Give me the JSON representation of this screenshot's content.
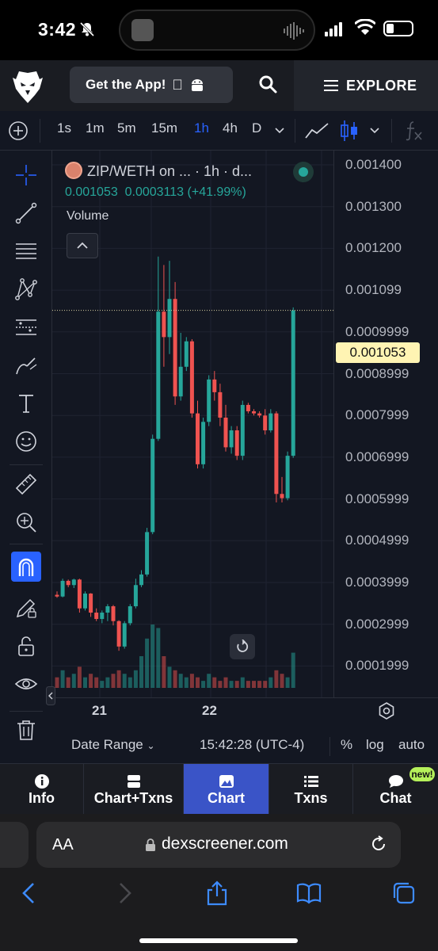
{
  "status_bar": {
    "time": "3:42"
  },
  "header": {
    "get_app_label": "Get the App!",
    "explore_label": "EXPLORE"
  },
  "toolbar": {
    "intervals": [
      "1s",
      "1m",
      "5m",
      "15m",
      "1h",
      "4h",
      "D"
    ],
    "active_interval": "1h"
  },
  "legend": {
    "pair": "ZIP/WETH on ... · 1h · d...",
    "price": "0.001053",
    "change": "0.0003113 (+41.99%)",
    "volume_label": "Volume"
  },
  "price_axis": {
    "labels": [
      "0.001400",
      "0.001300",
      "0.001200",
      "0.001099",
      "0.0009999",
      "0.0008999",
      "0.0007999",
      "0.0006999",
      "0.0005999",
      "0.0004999",
      "0.0003999",
      "0.0002999",
      "0.0001999"
    ],
    "last_price": "0.001053"
  },
  "time_axis": {
    "labels": [
      "21",
      "22"
    ]
  },
  "bottom_bar": {
    "date_range": "Date Range",
    "clock": "15:42:28 (UTC-4)",
    "percent": "%",
    "log": "log",
    "auto": "auto"
  },
  "tabs": [
    {
      "label": "Info",
      "icon": "info-icon"
    },
    {
      "label": "Chart+Txns",
      "icon": "split-icon"
    },
    {
      "label": "Chart",
      "icon": "mountain-chart-icon"
    },
    {
      "label": "Txns",
      "icon": "list-icon"
    },
    {
      "label": "Chat",
      "icon": "chat-bubble-icon"
    }
  ],
  "active_tab": "Chart",
  "new_badge": "new!",
  "safari": {
    "aa": "AA",
    "url": "dexscreener.com"
  },
  "colors": {
    "up": "#26a69a",
    "down": "#ef5350",
    "accent": "#2962ff",
    "background": "#131722"
  },
  "chart_data": {
    "type": "candlestick",
    "interval": "1h",
    "ylim": [
      0.00014,
      0.00143
    ],
    "candles": [
      {
        "o": 0.000382,
        "h": 0.00039,
        "l": 0.000375,
        "c": 0.000378,
        "v": 3e-05
      },
      {
        "o": 0.000378,
        "h": 0.00042,
        "l": 0.000376,
        "c": 0.000415,
        "v": 5e-05
      },
      {
        "o": 0.000415,
        "h": 0.000418,
        "l": 0.0004,
        "c": 0.000405,
        "v": 3e-05
      },
      {
        "o": 0.000405,
        "h": 0.00042,
        "l": 0.000398,
        "c": 0.000418,
        "v": 4e-05
      },
      {
        "o": 0.000418,
        "h": 0.00042,
        "l": 0.00034,
        "c": 0.00035,
        "v": 6e-05
      },
      {
        "o": 0.00035,
        "h": 0.00039,
        "l": 0.000345,
        "c": 0.000385,
        "v": 3e-05
      },
      {
        "o": 0.000385,
        "h": 0.000386,
        "l": 0.00033,
        "c": 0.00034,
        "v": 4e-05
      },
      {
        "o": 0.00034,
        "h": 0.00035,
        "l": 0.00032,
        "c": 0.000325,
        "v": 3e-05
      },
      {
        "o": 0.000325,
        "h": 0.000345,
        "l": 0.000315,
        "c": 0.00034,
        "v": 2e-05
      },
      {
        "o": 0.00034,
        "h": 0.00036,
        "l": 0.00032,
        "c": 0.000355,
        "v": 3e-05
      },
      {
        "o": 0.000355,
        "h": 0.000358,
        "l": 0.00031,
        "c": 0.00032,
        "v": 4e-05
      },
      {
        "o": 0.00032,
        "h": 0.000322,
        "l": 0.00025,
        "c": 0.00026,
        "v": 5e-05
      },
      {
        "o": 0.00026,
        "h": 0.00032,
        "l": 0.000255,
        "c": 0.000315,
        "v": 4e-05
      },
      {
        "o": 0.000315,
        "h": 0.00036,
        "l": 0.00031,
        "c": 0.000355,
        "v": 3e-05
      },
      {
        "o": 0.000355,
        "h": 0.00042,
        "l": 0.00035,
        "c": 0.000405,
        "v": 5e-05
      },
      {
        "o": 0.000405,
        "h": 0.00044,
        "l": 0.0004,
        "c": 0.00043,
        "v": 9e-05
      },
      {
        "o": 0.00043,
        "h": 0.00054,
        "l": 0.000425,
        "c": 0.00053,
        "v": 0.00014
      },
      {
        "o": 0.00053,
        "h": 0.00076,
        "l": 0.000525,
        "c": 0.00075,
        "v": 0.00018
      },
      {
        "o": 0.00075,
        "h": 0.00118,
        "l": 0.000745,
        "c": 0.00105,
        "v": 0.00017
      },
      {
        "o": 0.00105,
        "h": 0.00116,
        "l": 0.00092,
        "c": 0.00099,
        "v": 9e-05
      },
      {
        "o": 0.00099,
        "h": 0.00117,
        "l": 0.00095,
        "c": 0.00108,
        "v": 6e-05
      },
      {
        "o": 0.00108,
        "h": 0.00112,
        "l": 0.00083,
        "c": 0.00085,
        "v": 5e-05
      },
      {
        "o": 0.00085,
        "h": 0.001,
        "l": 0.00084,
        "c": 0.00092,
        "v": 4e-05
      },
      {
        "o": 0.00092,
        "h": 0.00099,
        "l": 0.00091,
        "c": 0.00098,
        "v": 3e-05
      },
      {
        "o": 0.00098,
        "h": 0.000985,
        "l": 0.0008,
        "c": 0.00081,
        "v": 4e-05
      },
      {
        "o": 0.00081,
        "h": 0.00084,
        "l": 0.00068,
        "c": 0.00069,
        "v": 3e-05
      },
      {
        "o": 0.00069,
        "h": 0.0008,
        "l": 0.00068,
        "c": 0.00079,
        "v": 2e-05
      },
      {
        "o": 0.00079,
        "h": 0.0009,
        "l": 0.00078,
        "c": 0.00089,
        "v": 4e-05
      },
      {
        "o": 0.00089,
        "h": 0.00091,
        "l": 0.00084,
        "c": 0.00086,
        "v": 3e-05
      },
      {
        "o": 0.00086,
        "h": 0.00088,
        "l": 0.00078,
        "c": 0.0008,
        "v": 2e-05
      },
      {
        "o": 0.0008,
        "h": 0.00083,
        "l": 0.00072,
        "c": 0.00073,
        "v": 3e-05
      },
      {
        "o": 0.00073,
        "h": 0.00078,
        "l": 0.000715,
        "c": 0.00077,
        "v": 2e-05
      },
      {
        "o": 0.00077,
        "h": 0.00078,
        "l": 0.0007,
        "c": 0.00071,
        "v": 2e-05
      },
      {
        "o": 0.00071,
        "h": 0.00084,
        "l": 0.0007,
        "c": 0.00083,
        "v": 3e-05
      },
      {
        "o": 0.00083,
        "h": 0.000835,
        "l": 0.00081,
        "c": 0.000815,
        "v": 2e-05
      },
      {
        "o": 0.000815,
        "h": 0.00082,
        "l": 0.000805,
        "c": 0.00081,
        "v": 2e-05
      },
      {
        "o": 0.00081,
        "h": 0.000815,
        "l": 0.0008,
        "c": 0.000805,
        "v": 2e-05
      },
      {
        "o": 0.000805,
        "h": 0.00082,
        "l": 0.00076,
        "c": 0.00077,
        "v": 2e-05
      },
      {
        "o": 0.00077,
        "h": 0.00082,
        "l": 0.000765,
        "c": 0.00081,
        "v": 3e-05
      },
      {
        "o": 0.00081,
        "h": 0.000815,
        "l": 0.0006,
        "c": 0.00062,
        "v": 5e-05
      },
      {
        "o": 0.00062,
        "h": 0.00066,
        "l": 0.0006,
        "c": 0.00061,
        "v": 4e-05
      },
      {
        "o": 0.00061,
        "h": 0.00072,
        "l": 0.000605,
        "c": 0.00071,
        "v": 3e-05
      },
      {
        "o": 0.00071,
        "h": 0.00106,
        "l": 0.000705,
        "c": 0.001053,
        "v": 0.0001
      }
    ]
  }
}
